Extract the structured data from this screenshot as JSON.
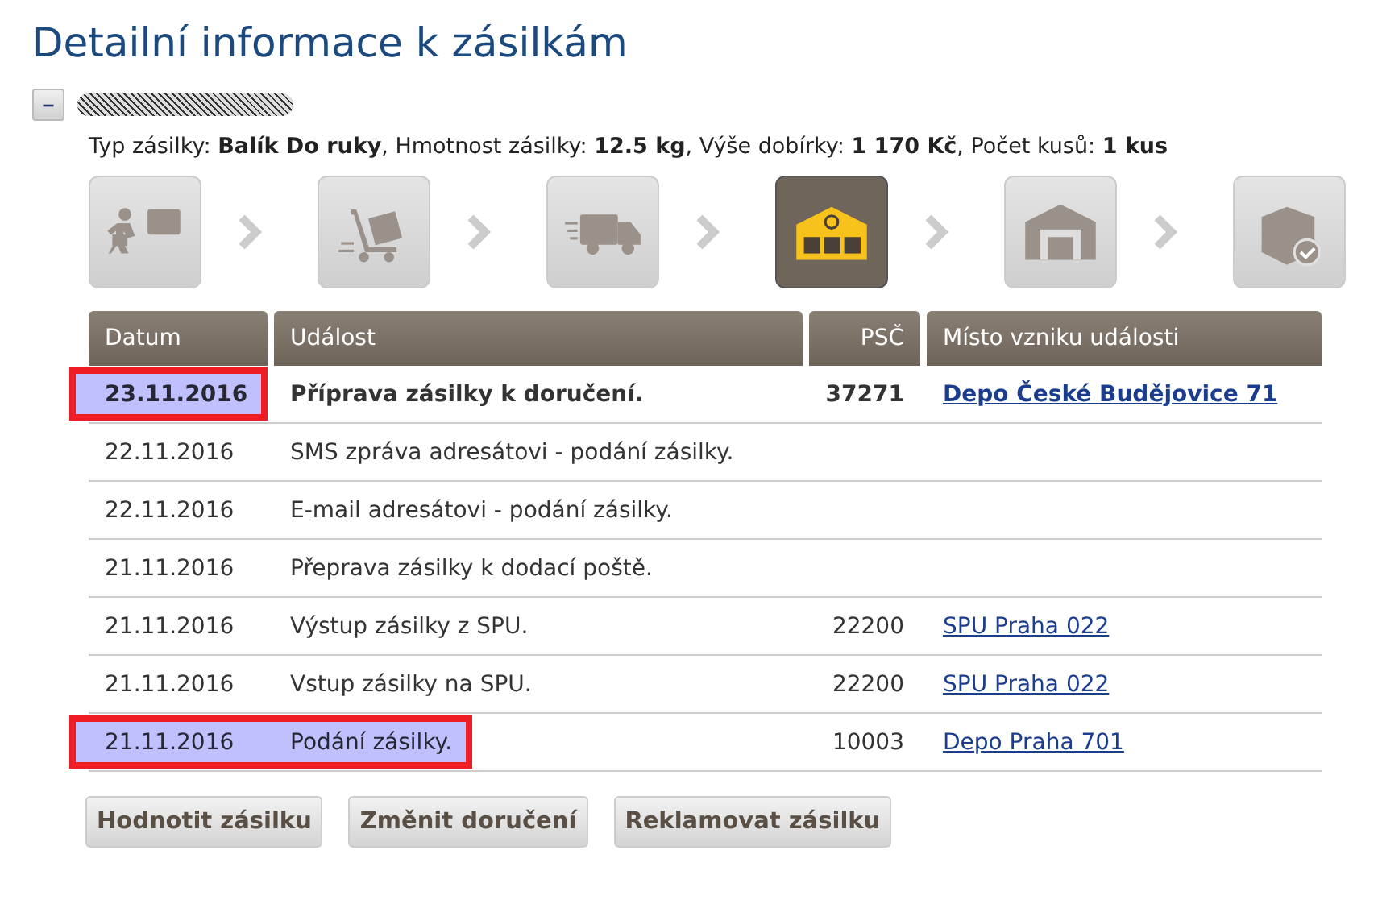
{
  "title": "Detailní informace k zásilkám",
  "shipment": {
    "toggle": "–",
    "expanded": true,
    "info": "Typ zásilky: **Balík Do ruky**, Hmotnost zásilky: **12.5 kg**, Výše dobírky: **1 170 Kč**, Počet kusů: **1 kus**"
  },
  "steps": [
    {
      "kind": "handover",
      "selected": false
    },
    {
      "kind": "trolley",
      "selected": false
    },
    {
      "kind": "truck",
      "selected": false
    },
    {
      "kind": "depot",
      "selected": true
    },
    {
      "kind": "warehouse",
      "selected": false
    },
    {
      "kind": "delivered",
      "selected": false
    }
  ],
  "table": {
    "columns": [
      "Datum",
      "Událost",
      "PSČ",
      "Místo vzniku události"
    ],
    "rows": [
      {
        "date": "23.11.2016",
        "event": "Příprava zásilky k doručení.",
        "psc": "37271",
        "place": "Depo České Budějovice 71",
        "bold": true,
        "date_marked": true,
        "event_marked": false
      },
      {
        "date": "22.11.2016",
        "event": "SMS zpráva adresátovi - podání zásilky.",
        "bold": false,
        "date_marked": false,
        "event_marked": false
      },
      {
        "date": "22.11.2016",
        "event": "E-mail adresátovi - podání zásilky.",
        "bold": false,
        "date_marked": false,
        "event_marked": false
      },
      {
        "date": "21.11.2016",
        "event": "Přeprava zásilky k dodací poště.",
        "bold": false,
        "date_marked": false,
        "event_marked": false
      },
      {
        "date": "21.11.2016",
        "event": "Výstup zásilky z SPU.",
        "psc": "22200",
        "place": "SPU Praha 022",
        "bold": false,
        "date_marked": false,
        "event_marked": false
      },
      {
        "date": "21.11.2016",
        "event": "Vstup zásilky na SPU.",
        "psc": "22200",
        "place": "SPU Praha 022",
        "bold": false,
        "date_marked": false,
        "event_marked": false
      },
      {
        "date": "21.11.2016",
        "event": "Podání zásilky.",
        "psc": "10003",
        "place": "Depo Praha 701",
        "bold": false,
        "date_marked": true,
        "event_marked": true
      }
    ]
  },
  "buttons": [
    "Hodnotit zásilku",
    "Změnit doručení",
    "Reklamovat zásilku"
  ]
}
